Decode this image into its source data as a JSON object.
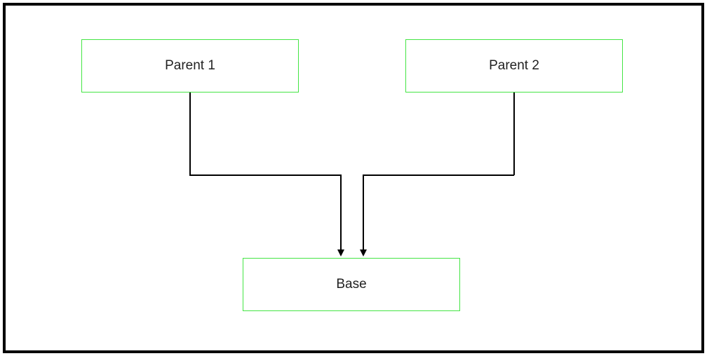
{
  "nodes": {
    "parent1": {
      "label": "Parent 1"
    },
    "parent2": {
      "label": "Parent 2"
    },
    "base": {
      "label": "Base"
    }
  },
  "colors": {
    "nodeBorder": "#44e544",
    "connector": "#000000",
    "frame": "#000000"
  },
  "diagram": {
    "description": "Two parent nodes converge via right-angle connectors into a single Base node below."
  }
}
